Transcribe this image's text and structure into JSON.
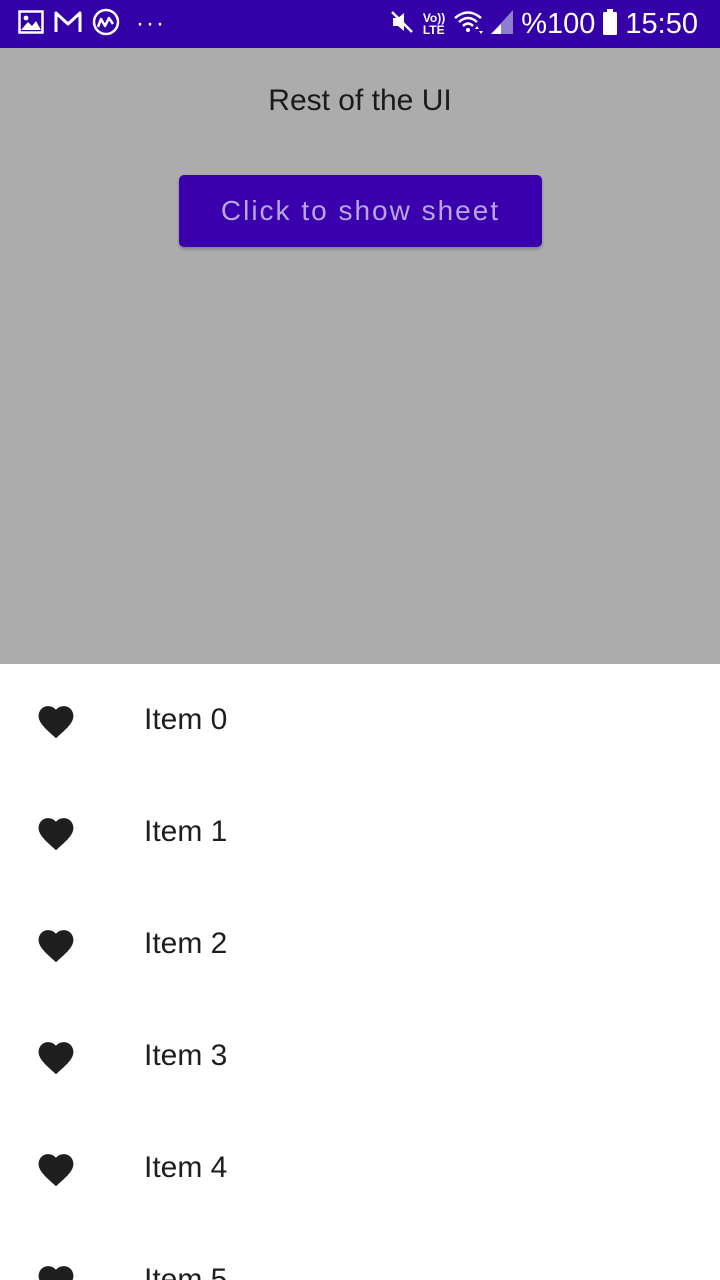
{
  "status_bar": {
    "battery_text": "%100",
    "time": "15:50",
    "volte_top": "Vo))",
    "volte_bottom": "LTE",
    "more": "···",
    "left_icons": [
      "gallery-icon",
      "gmail-icon",
      "coinmarketcap-icon"
    ],
    "right_icons": [
      "mute-icon",
      "volte-icon",
      "wifi-icon",
      "signal-icon",
      "battery-icon"
    ],
    "background": "#3400a8"
  },
  "main": {
    "title": "Rest of the UI",
    "button_label": "Click to show sheet",
    "button_color": "#3a00ad",
    "background": "#acacac"
  },
  "sheet": {
    "items": [
      {
        "label": "Item 0",
        "icon": "heart-icon"
      },
      {
        "label": "Item 1",
        "icon": "heart-icon"
      },
      {
        "label": "Item 2",
        "icon": "heart-icon"
      },
      {
        "label": "Item 3",
        "icon": "heart-icon"
      },
      {
        "label": "Item 4",
        "icon": "heart-icon"
      },
      {
        "label": "Item 5",
        "icon": "heart-icon"
      }
    ]
  }
}
